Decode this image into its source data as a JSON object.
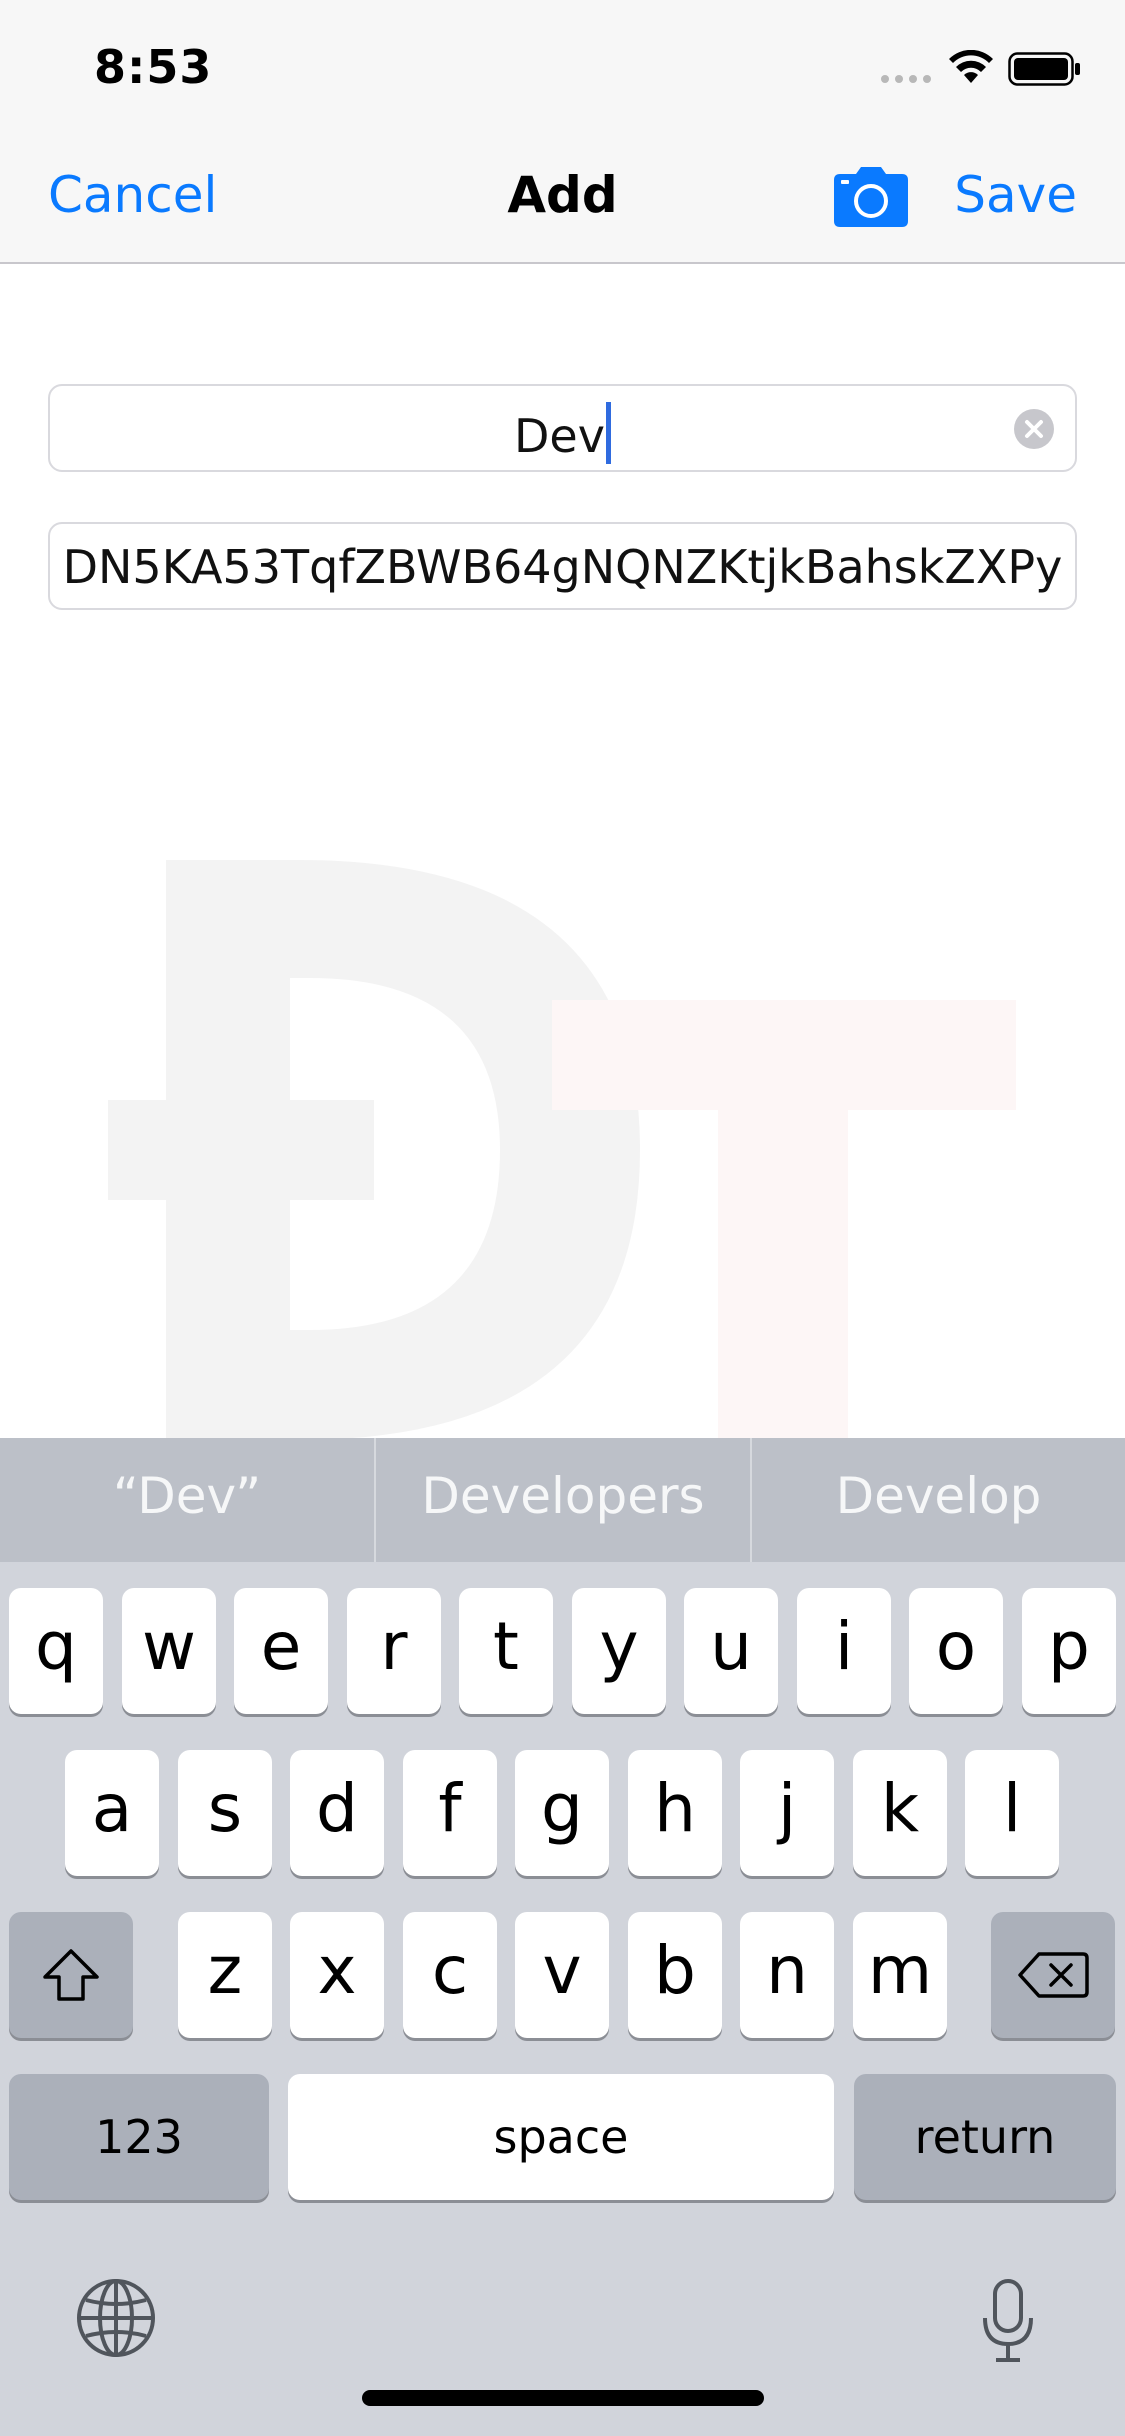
{
  "status_bar": {
    "time": "8:53"
  },
  "nav": {
    "cancel_label": "Cancel",
    "title": "Add",
    "save_label": "Save",
    "camera_icon": "camera-icon"
  },
  "form": {
    "name_value": "Dev",
    "address_value": "DN5KA53TqfZBWB64gNQNZKtjkBahskZXPy"
  },
  "keyboard": {
    "suggestions": [
      "“Dev”",
      "Developers",
      "Develop"
    ],
    "row1": [
      "q",
      "w",
      "e",
      "r",
      "t",
      "y",
      "u",
      "i",
      "o",
      "p"
    ],
    "row2": [
      "a",
      "s",
      "d",
      "f",
      "g",
      "h",
      "j",
      "k",
      "l"
    ],
    "row3": [
      "z",
      "x",
      "c",
      "v",
      "b",
      "n",
      "m"
    ],
    "numbers_label": "123",
    "space_label": "space",
    "return_label": "return"
  },
  "colors": {
    "accent": "#0a7aff",
    "keyboard_bg": "#d1d4db",
    "suggestion_bar": "#bcc0c8",
    "dark_key": "#abb0ba"
  }
}
